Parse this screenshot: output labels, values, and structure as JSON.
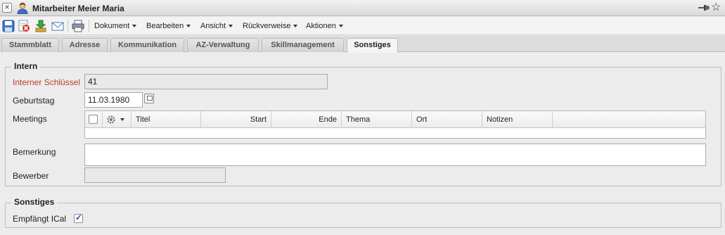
{
  "window": {
    "title": "Mitarbeiter Meier Maria",
    "close_glyph": "×",
    "star_glyph": "☆"
  },
  "toolbar": {
    "icons": [
      "save-icon",
      "delete-icon",
      "download-icon",
      "email-icon",
      "print-icon"
    ],
    "menus": [
      "Dokument",
      "Bearbeiten",
      "Ansicht",
      "Rückverweise",
      "Aktionen"
    ]
  },
  "tabs": [
    "Stammblatt",
    "Adresse",
    "Kommunikation",
    "AZ-Verwaltung",
    "Skillmanagement",
    "Sonstiges"
  ],
  "active_tab": "Sonstiges",
  "intern": {
    "legend": "Intern",
    "schluessel_label": "Interner Schlüssel",
    "schluessel_value": "41",
    "geburtstag_label": "Geburtstag",
    "geburtstag_value": "11.03.1980",
    "meetings_label": "Meetings",
    "meetings_columns": [
      "Titel",
      "Start",
      "Ende",
      "Thema",
      "Ort",
      "Notizen"
    ],
    "bemerkung_label": "Bemerkung",
    "bemerkung_value": "",
    "bewerber_label": "Bewerber",
    "bewerber_value": ""
  },
  "sonstiges": {
    "legend": "Sonstiges",
    "ical_label": "Empfängt ICal",
    "ical_checked": true
  },
  "colors": {
    "required_label": "#c0392b",
    "checkbox_tick": "#2a4ea8"
  }
}
